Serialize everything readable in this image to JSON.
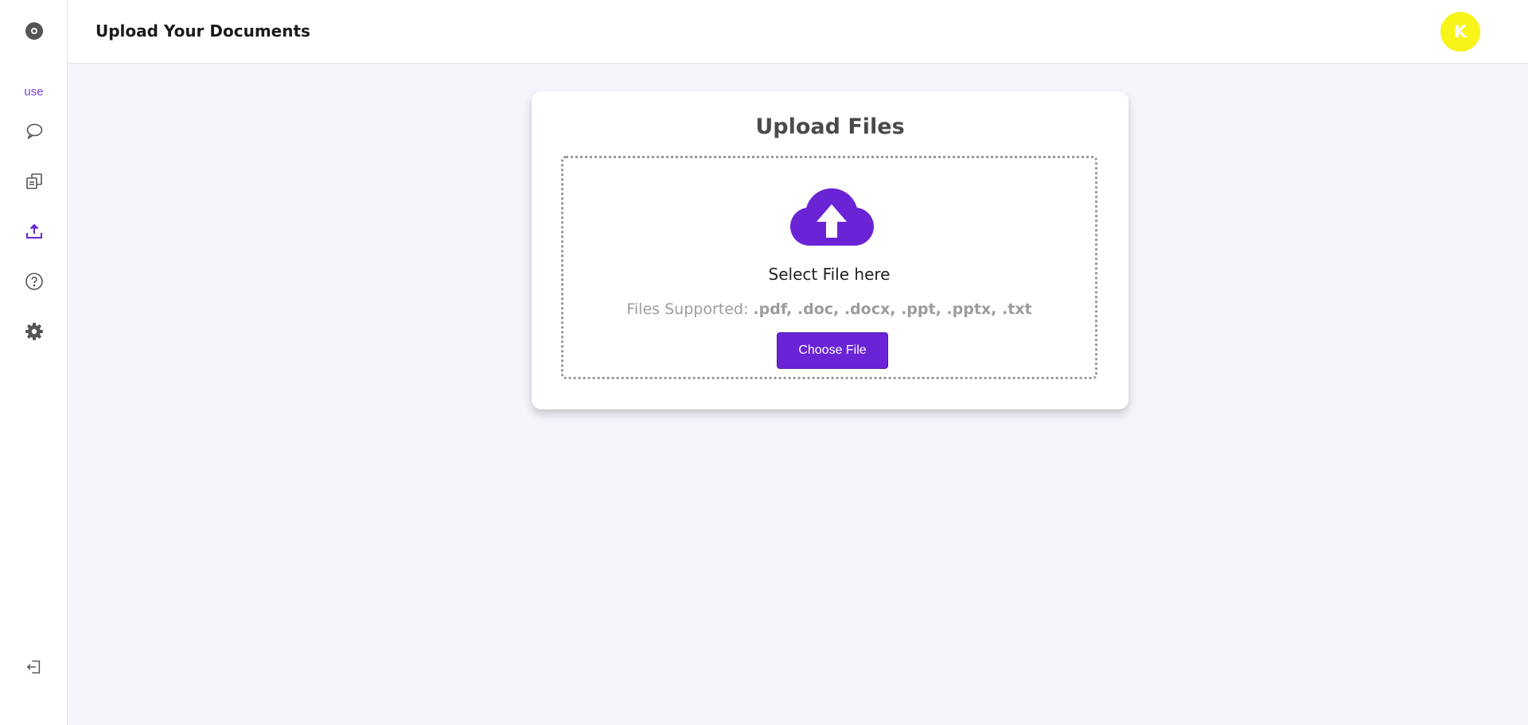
{
  "sidebar": {
    "items": [
      {
        "icon": "disc-logo-icon"
      },
      {
        "label": "use"
      },
      {
        "icon": "chat-bubble-icon"
      },
      {
        "icon": "documents-icon"
      },
      {
        "icon": "upload-icon",
        "active": true
      },
      {
        "icon": "help-circle-icon"
      },
      {
        "icon": "gear-icon"
      },
      {
        "icon": "logout-icon"
      }
    ]
  },
  "header": {
    "title": "Upload Your Documents",
    "avatar_initial": "K",
    "avatar_color": "#f7f41a"
  },
  "upload": {
    "title": "Upload Files",
    "select_text": "Select File here",
    "supported_label": "Files Supported:",
    "supported_types": ".pdf, .doc, .docx, .ppt, .pptx, .txt",
    "button_label": "Choose File",
    "icon": "cloud-upload-icon"
  },
  "colors": {
    "accent": "#6a24d6",
    "background": "#f7f5fc"
  }
}
